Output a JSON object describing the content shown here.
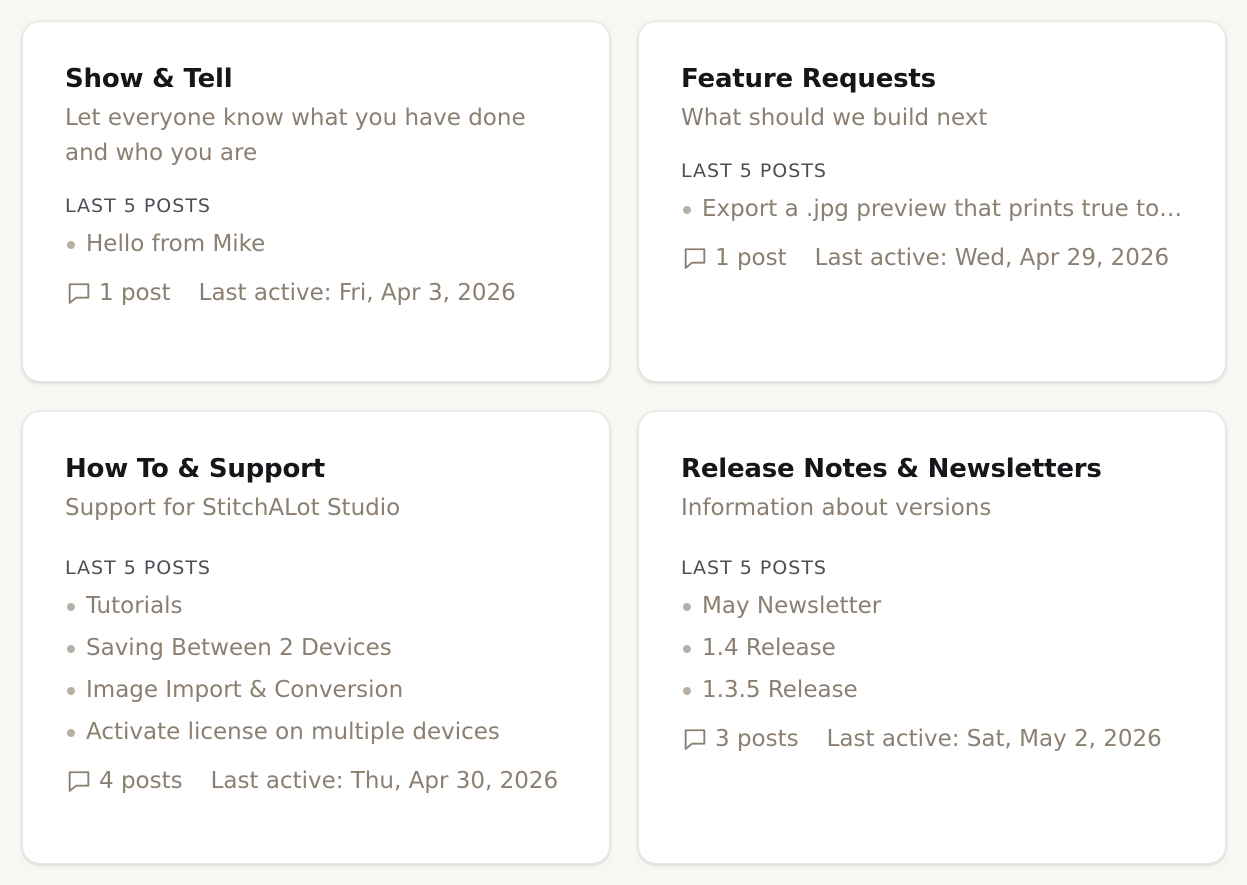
{
  "categories": [
    {
      "title": "Show & Tell",
      "description": "Let everyone know what you have done and who you are",
      "section_label": "LAST 5 POSTS",
      "posts": [
        "Hello from Mike"
      ],
      "count_label": "1 post",
      "last_active": "Last active: Fri, Apr 3, 2026"
    },
    {
      "title": "Feature Requests",
      "description": "What should we build next",
      "section_label": "LAST 5 POSTS",
      "posts": [
        "Export a .jpg preview that prints true to ..."
      ],
      "count_label": "1 post",
      "last_active": "Last active: Wed, Apr 29, 2026"
    },
    {
      "title": "How To & Support",
      "description": "Support for StitchALot Studio",
      "section_label": "LAST 5 POSTS",
      "posts": [
        "Tutorials",
        "Saving Between 2 Devices",
        "Image Import & Conversion",
        "Activate license on multiple devices"
      ],
      "count_label": "4 posts",
      "last_active": "Last active: Thu, Apr 30, 2026"
    },
    {
      "title": "Release Notes & Newsletters",
      "description": "Information about versions",
      "section_label": "LAST 5 POSTS",
      "posts": [
        "May Newsletter",
        "1.4 Release",
        "1.3.5 Release"
      ],
      "count_label": "3 posts",
      "last_active": "Last active: Sat, May 2, 2026"
    }
  ],
  "icons": {
    "post_count": "chat-bubble-icon"
  },
  "colors": {
    "background": "#f8f7f4",
    "card": "#ffffff",
    "title": "#16161a",
    "muted": "#8b7f72",
    "label": "#4d4d55",
    "bullet": "#b8b0a6"
  }
}
